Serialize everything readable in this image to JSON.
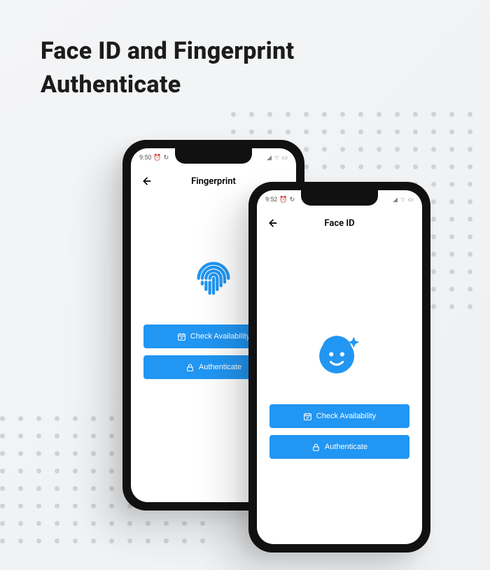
{
  "headline": {
    "line1": "Face ID and Fingerprint",
    "line2": "Authenticate"
  },
  "phone_fingerprint": {
    "status_time": "9:50",
    "title": "Fingerprint",
    "icon": "fingerprint-icon",
    "button_check": "Check Availability",
    "button_auth": "Authenticate"
  },
  "phone_faceid": {
    "status_time": "9:52",
    "title": "Face ID",
    "icon": "face-icon",
    "button_check": "Check Availability",
    "button_auth": "Authenticate"
  },
  "colors": {
    "accent": "#2196f3",
    "text": "#1c1c1c",
    "dot": "#cfd3d7"
  }
}
